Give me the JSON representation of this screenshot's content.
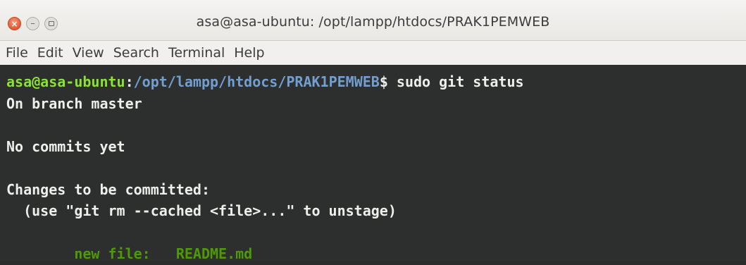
{
  "window": {
    "title": "asa@asa-ubuntu: /opt/lampp/htdocs/PRAK1PEMWEB",
    "controls": {
      "close": "×",
      "minimize": "–"
    }
  },
  "menubar": {
    "items": [
      "File",
      "Edit",
      "View",
      "Search",
      "Terminal",
      "Help"
    ]
  },
  "terminal": {
    "prompt_user": "asa@asa-ubuntu",
    "prompt_sep": ":",
    "prompt_path": "/opt/lampp/htdocs/PRAK1PEMWEB",
    "prompt_symbol": "$",
    "command": " sudo git status",
    "output": {
      "branch": "On branch master",
      "commits": "No commits yet",
      "changes_header": "Changes to be committed:",
      "hint": "  (use \"git rm --cached <file>...\" to unstage)",
      "staged_prefix": "        new file:   ",
      "staged_file": "README.md"
    }
  },
  "colors": {
    "user": "#8ae234",
    "path": "#729fcf",
    "staged": "#4e9a06",
    "background": "#2d2e2e",
    "text": "#eeeeec"
  }
}
